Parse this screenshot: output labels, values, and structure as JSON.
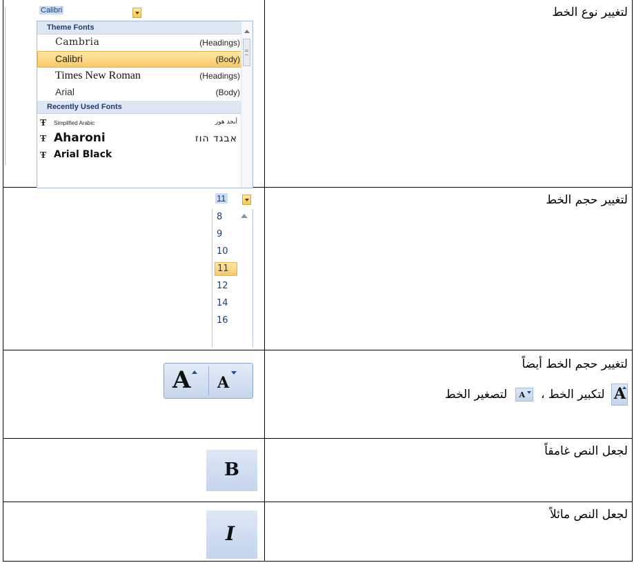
{
  "rows": [
    {
      "text": "لتغيير نوع الخط"
    },
    {
      "text": "لتغيير حجم الخط"
    },
    {
      "text_line1": "لتغيير حجم الخط أيضاً",
      "grow_text": "لتكبير الخط ،",
      "shrink_text": "لتصغير الخط"
    },
    {
      "text": "لجعل النص غامقاً"
    },
    {
      "text": "لجعل النص مائلاً"
    }
  ],
  "font_dropdown": {
    "current": "Calibri",
    "theme_header": "Theme Fonts",
    "theme_fonts": [
      {
        "name": "Cambria",
        "tag": "(Headings)"
      },
      {
        "name": "Calibri",
        "tag": "(Body)"
      },
      {
        "name": "Times New Roman",
        "tag": "(Headings)"
      },
      {
        "name": "Arial",
        "tag": "(Body)"
      }
    ],
    "recent_header": "Recently Used Fonts",
    "recent_fonts": [
      {
        "name": "Simplified Arabic",
        "sample": "أبجد هوز"
      },
      {
        "name": "Aharoni",
        "sample": "אבגד הוז"
      },
      {
        "name": "Arial Black",
        "sample": ""
      }
    ],
    "tt_glyph": "Ŧ"
  },
  "size_dropdown": {
    "current": "11",
    "options": [
      "8",
      "9",
      "10",
      "11",
      "12",
      "14",
      "16"
    ]
  },
  "grow_glyph": "A",
  "shrink_glyph": "A",
  "bold_glyph": "B",
  "italic_glyph": "I"
}
